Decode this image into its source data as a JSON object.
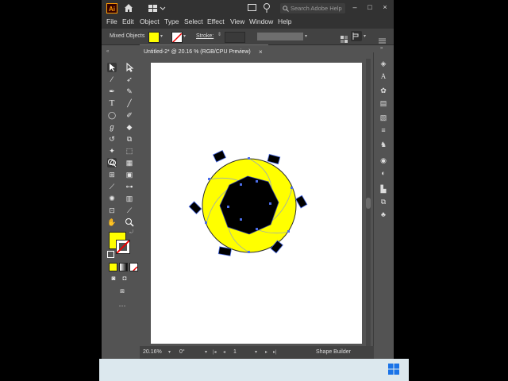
{
  "window": {
    "app_logo": "Ai",
    "search_placeholder": "Search Adobe Help",
    "controls": {
      "minimize": "–",
      "maximize": "□",
      "close": "×"
    }
  },
  "menu": [
    "File",
    "Edit",
    "Object",
    "Type",
    "Select",
    "Effect",
    "View",
    "Window",
    "Help"
  ],
  "control_bar": {
    "selection_label": "Mixed Objects",
    "stroke_label": "Stroke:",
    "fill_color": "#ffff00"
  },
  "document_tab": {
    "title": "Untitled-2* @ 20.16 % (RGB/CPU Preview)",
    "close": "×"
  },
  "status_bar": {
    "zoom": "20.16%",
    "rotation": "0°",
    "page": "1",
    "active_tool": "Shape Builder"
  },
  "colors": {
    "fill": "#ffff00",
    "accent": "#4a9eff"
  }
}
